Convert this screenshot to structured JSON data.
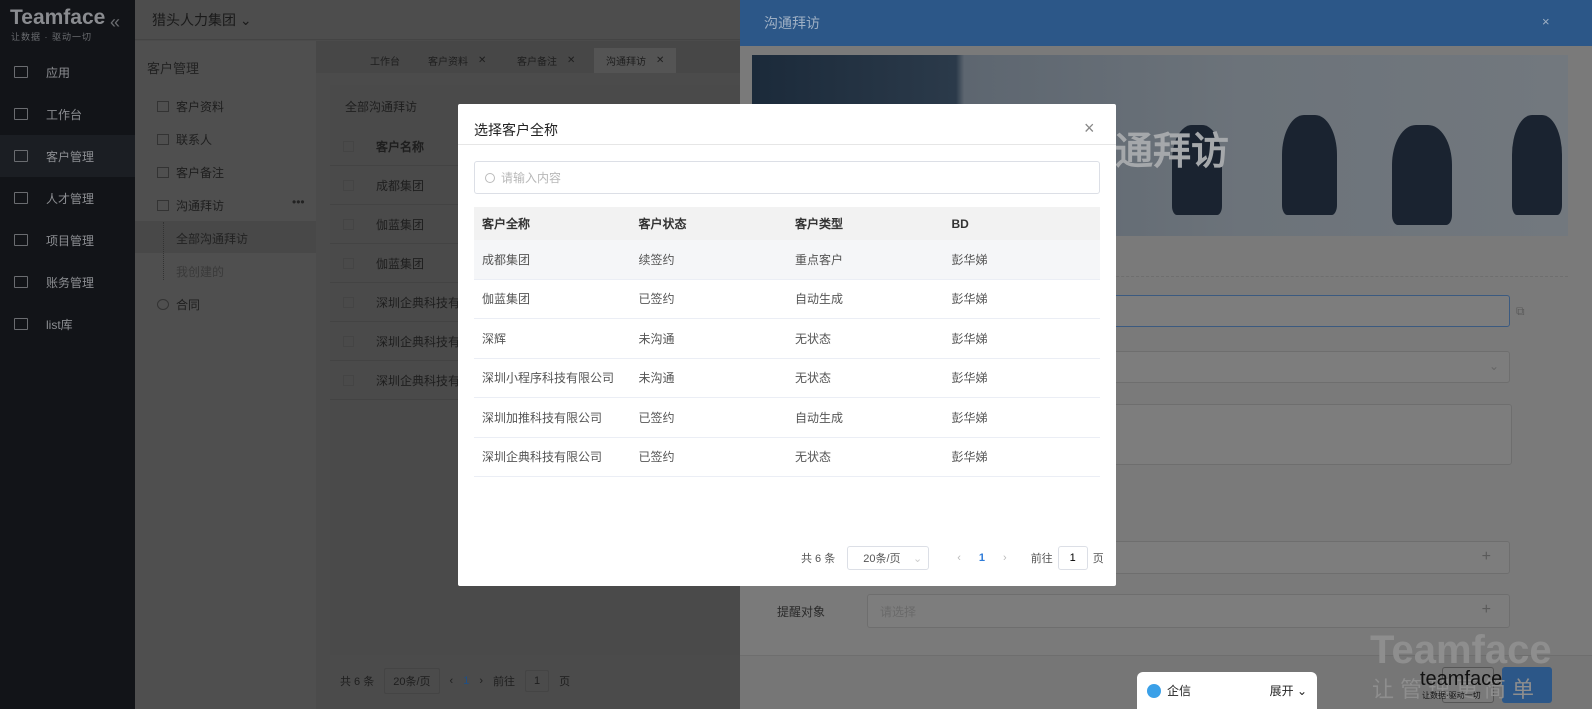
{
  "sidebar": {
    "logo": "Teamface",
    "slogan": "让数据 · 驱动一切",
    "items": [
      {
        "label": "应用",
        "icon": "grid-icon"
      },
      {
        "label": "工作台",
        "icon": "dashboard-icon"
      },
      {
        "label": "客户管理",
        "icon": "users-icon",
        "active": true
      },
      {
        "label": "人才管理",
        "icon": "talent-icon"
      },
      {
        "label": "项目管理",
        "icon": "project-icon"
      },
      {
        "label": "账务管理",
        "icon": "finance-icon"
      },
      {
        "label": "list库",
        "icon": "list-icon"
      }
    ]
  },
  "topbar": {
    "company": "猎头人力集团"
  },
  "subnav": {
    "title": "客户管理",
    "items": [
      "客户资料",
      "联系人",
      "客户备注",
      "沟通拜访"
    ],
    "children": [
      "全部沟通拜访",
      "我创建的"
    ],
    "last": "合同"
  },
  "tabs": [
    {
      "label": "工作台",
      "closable": false
    },
    {
      "label": "客户资料",
      "closable": true
    },
    {
      "label": "客户备注",
      "closable": true
    },
    {
      "label": "沟通拜访",
      "closable": true,
      "active": true
    }
  ],
  "list": {
    "title": "全部沟通拜访",
    "header": "客户名称",
    "rows": [
      "成都集团",
      "伽蓝集团",
      "伽蓝集团",
      "深圳企典科技有",
      "深圳企典科技有",
      "深圳企典科技有"
    ],
    "pagination": {
      "total": "共 6 条",
      "size": "20条/页",
      "page": "1",
      "goto": "前往",
      "goto_value": "1",
      "page_unit": "页"
    }
  },
  "panel": {
    "title": "沟通拜访",
    "close": "×",
    "banner_text": "通拜访",
    "remind_label": "提醒对象",
    "remind_placeholder": "请选择",
    "watermark": "Teamface",
    "watermark_sub": "让管理更简单",
    "logo": "teamface",
    "logo_sub": "让数据·驱动一切"
  },
  "qixin": {
    "label": "企信",
    "expand": "展开"
  },
  "modal": {
    "title": "选择客户全称",
    "close": "×",
    "search_placeholder": "请输入内容",
    "columns": [
      "客户全称",
      "客户状态",
      "客户类型",
      "BD"
    ],
    "rows": [
      [
        "成都集团",
        "续签约",
        "重点客户",
        "彭华娣"
      ],
      [
        "伽蓝集团",
        "已签约",
        "自动生成",
        "彭华娣"
      ],
      [
        "深辉",
        "未沟通",
        "无状态",
        "彭华娣"
      ],
      [
        "深圳小程序科技有限公司",
        "未沟通",
        "无状态",
        "彭华娣"
      ],
      [
        "深圳加推科技有限公司",
        "已签约",
        "自动生成",
        "彭华娣"
      ],
      [
        "深圳企典科技有限公司",
        "已签约",
        "无状态",
        "彭华娣"
      ]
    ],
    "pagination": {
      "total": "共 6 条",
      "size": "20条/页",
      "page": "1",
      "goto": "前往",
      "goto_value": "1",
      "page_unit": "页"
    }
  }
}
